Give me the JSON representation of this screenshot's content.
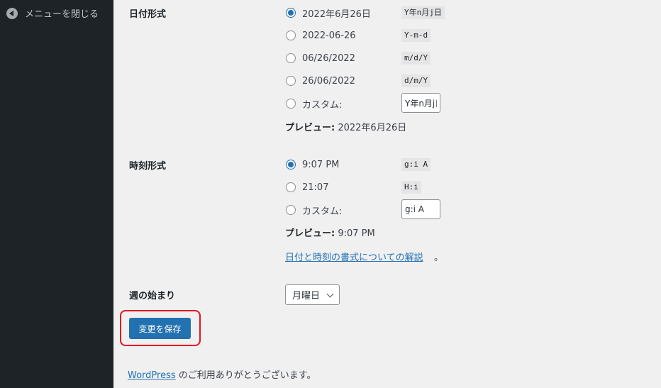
{
  "sidebar": {
    "collapse_label": "メニューを閉じる",
    "collapse_icon": "arrow-left-circle-icon"
  },
  "date_format": {
    "label": "日付形式",
    "options": [
      {
        "label": "2022年6月26日",
        "code": "Y年n月j日",
        "checked": true
      },
      {
        "label": "2022-06-26",
        "code": "Y-m-d",
        "checked": false
      },
      {
        "label": "06/26/2022",
        "code": "m/d/Y",
        "checked": false
      },
      {
        "label": "26/06/2022",
        "code": "d/m/Y",
        "checked": false
      }
    ],
    "custom_label": "カスタム:",
    "custom_value": "Y年n月j日",
    "preview_label": "プレビュー:",
    "preview_value": " 2022年6月26日"
  },
  "time_format": {
    "label": "時刻形式",
    "options": [
      {
        "label": "9:07 PM",
        "code": "g:i A",
        "checked": true
      },
      {
        "label": "21:07",
        "code": "H:i",
        "checked": false
      }
    ],
    "custom_label": "カスタム:",
    "custom_value": "g:i A",
    "preview_label": "プレビュー:",
    "preview_value": " 9:07 PM",
    "help_link": "日付と時刻の書式についての解説",
    "help_suffix": "。"
  },
  "week_start": {
    "label": "週の始まり",
    "selected": "月曜日"
  },
  "save_button": "変更を保存",
  "footer": {
    "link": "WordPress",
    "text": " のご利用ありがとうございます。"
  },
  "colors": {
    "sidebar_bg": "#1d2327",
    "accent": "#2271b1",
    "highlight": "#e0161d",
    "page_bg": "#f0f0f1"
  }
}
